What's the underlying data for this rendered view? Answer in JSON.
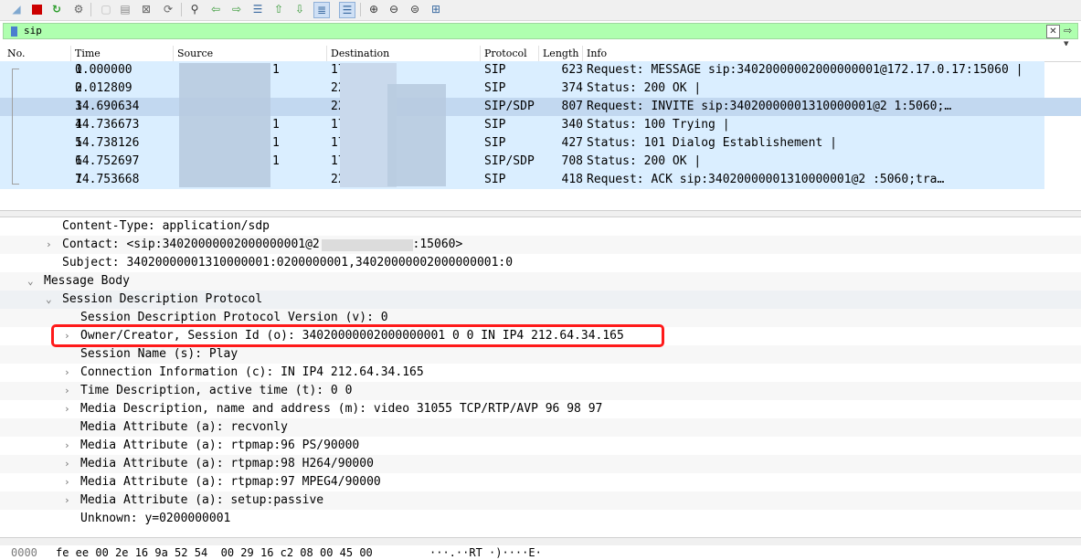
{
  "toolbar": {
    "icons": [
      "shark-fin-icon",
      "stop-icon",
      "restart-icon",
      "options-icon",
      "open-icon",
      "save-icon",
      "close-file-icon",
      "reload-icon",
      "find-icon",
      "back-icon",
      "forward-icon",
      "go-to-packet-icon",
      "first-packet-icon",
      "last-packet-icon",
      "autoscroll-icon",
      "colorize-icon",
      "zoom-in-icon",
      "zoom-out-icon",
      "normal-size-icon",
      "resize-columns-icon"
    ],
    "accent_stop": "#cc0000",
    "accent_green": "#2e9e2e"
  },
  "filter": {
    "value": "sip",
    "clear_label": "✕",
    "dropdown_label": "⇨ ▾"
  },
  "packet_list": {
    "columns": [
      "No.",
      "Time",
      "Source",
      "Destination",
      "Protocol",
      "Length",
      "Info"
    ],
    "rows": [
      {
        "no": "1",
        "time": "0.000000",
        "src": "1",
        "dst": "17",
        "proto": "SIP",
        "len": "623",
        "info": "Request: MESSAGE sip:34020000002000000001@172.17.0.17:15060 |"
      },
      {
        "no": "2",
        "time": "0.012809",
        "src": "",
        "dst": "22",
        "proto": "SIP",
        "len": "374",
        "info": "Status: 200 OK |"
      },
      {
        "no": "3",
        "time": "14.690634",
        "src": "",
        "dst": "22",
        "proto": "SIP/SDP",
        "len": "807",
        "info": "Request: INVITE sip:34020000001310000001@2                1:5060;…"
      },
      {
        "no": "4",
        "time": "14.736673",
        "src": "1",
        "dst": "17",
        "proto": "SIP",
        "len": "340",
        "info": "Status: 100 Trying |"
      },
      {
        "no": "5",
        "time": "14.738126",
        "src": "1",
        "dst": "17",
        "proto": "SIP",
        "len": "427",
        "info": "Status: 101 Dialog Establishement |"
      },
      {
        "no": "6",
        "time": "14.752697",
        "src": "1",
        "dst": "17",
        "proto": "SIP/SDP",
        "len": "708",
        "info": "Status: 200 OK |"
      },
      {
        "no": "7",
        "time": "14.753668",
        "src": "",
        "dst": "22",
        "proto": "SIP",
        "len": "418",
        "info": "Request: ACK sip:34020000001310000001@2            :5060;tra…"
      }
    ],
    "selected_index": 2,
    "row_color": "#daeeff",
    "selected_color": "#c2d8f0"
  },
  "details": {
    "lines": [
      {
        "text": "Content-Type: application/sdp",
        "arrow": ""
      },
      {
        "text": "Contact: <sip:34020000002000000001@2             :15060>",
        "arrow": "›"
      },
      {
        "text": "Subject: 34020000001310000001:0200000001,34020000002000000001:0",
        "arrow": ""
      },
      {
        "text": "Message Body",
        "arrow": "⌄"
      },
      {
        "text": "Session Description Protocol",
        "arrow": "⌄"
      },
      {
        "text": "Session Description Protocol Version (v): 0",
        "arrow": ""
      },
      {
        "text": "Owner/Creator, Session Id (o): 34020000002000000001 0 0 IN IP4 212.64.34.165",
        "arrow": "›"
      },
      {
        "text": "Session Name (s): Play",
        "arrow": ""
      },
      {
        "text": "Connection Information (c): IN IP4 212.64.34.165",
        "arrow": "›"
      },
      {
        "text": "Time Description, active time (t): 0 0",
        "arrow": "›"
      },
      {
        "text": "Media Description, name and address (m): video 31055 TCP/RTP/AVP 96 98 97",
        "arrow": "›"
      },
      {
        "text": "Media Attribute (a): recvonly",
        "arrow": ""
      },
      {
        "text": "Media Attribute (a): rtpmap:96 PS/90000",
        "arrow": "›"
      },
      {
        "text": "Media Attribute (a): rtpmap:98 H264/90000",
        "arrow": "›"
      },
      {
        "text": "Media Attribute (a): rtpmap:97 MPEG4/90000",
        "arrow": "›"
      },
      {
        "text": "Media Attribute (a): setup:passive",
        "arrow": "›"
      },
      {
        "text": "Unknown: y=0200000001",
        "arrow": ""
      }
    ],
    "highlight_color": "#ff1a1a"
  },
  "bytes": {
    "offset": "0000",
    "hex": "fe ee 00 2e 16 9a 52 54  00 29 16 c2 08 00 45 00",
    "ascii": "···.··RT ·)····E·"
  }
}
